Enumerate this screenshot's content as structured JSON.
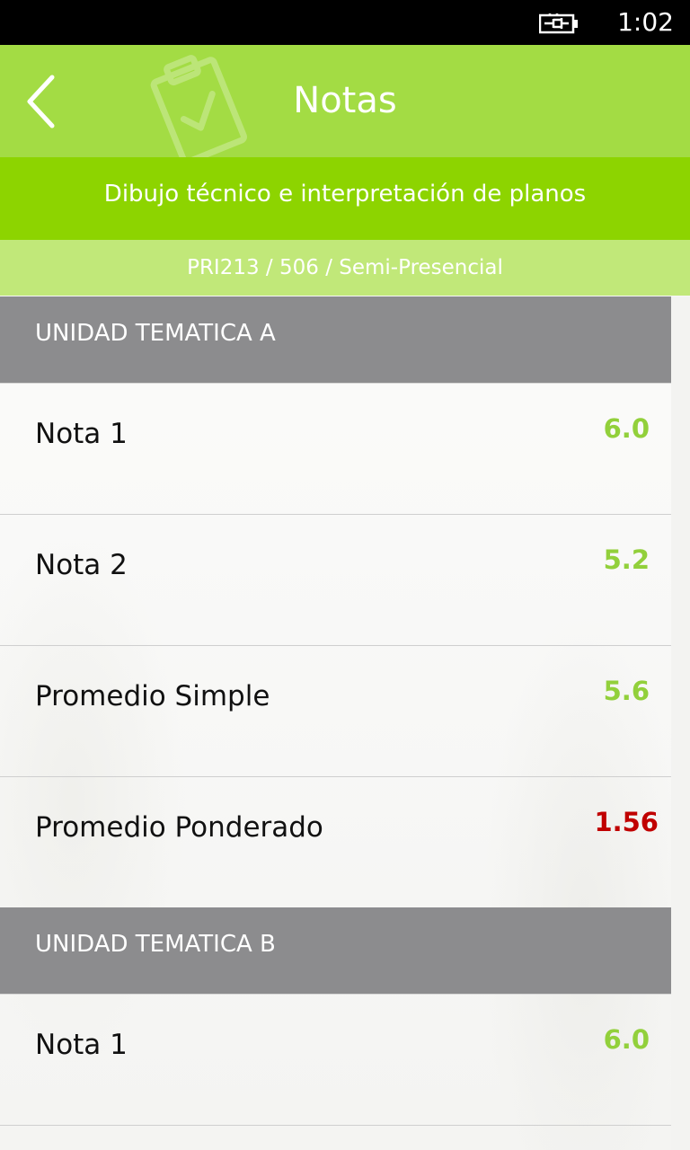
{
  "status_bar": {
    "time": "1:02",
    "battery_icon": "battery-charging-icon"
  },
  "header": {
    "title": "Notas",
    "back_icon": "chevron-left-icon",
    "decor_icon": "clipboard-check-icon",
    "color": "#a3dc44"
  },
  "course": {
    "name": "Dibujo técnico e interpretación de planos",
    "code": "PRI213 / 506 / Semi-Presencial",
    "bar_color": "#8dd400",
    "code_bar_color": "#c1e879"
  },
  "sections": [
    {
      "title": "UNIDAD TEMATICA A",
      "rows": [
        {
          "label": "Nota 1",
          "value": "6.0"
        },
        {
          "label": "Nota 2",
          "value": "5.2"
        },
        {
          "label": "Promedio Simple",
          "value": "5.6"
        },
        {
          "label": "Promedio Ponderado",
          "value": "1.56"
        }
      ]
    },
    {
      "title": "UNIDAD TEMATICA B",
      "rows": [
        {
          "label": "Nota 1",
          "value": "6.0"
        }
      ]
    }
  ],
  "colors": {
    "pass": "#92d03b",
    "fail": "#c00000",
    "section_header": "#8c8c8e"
  }
}
